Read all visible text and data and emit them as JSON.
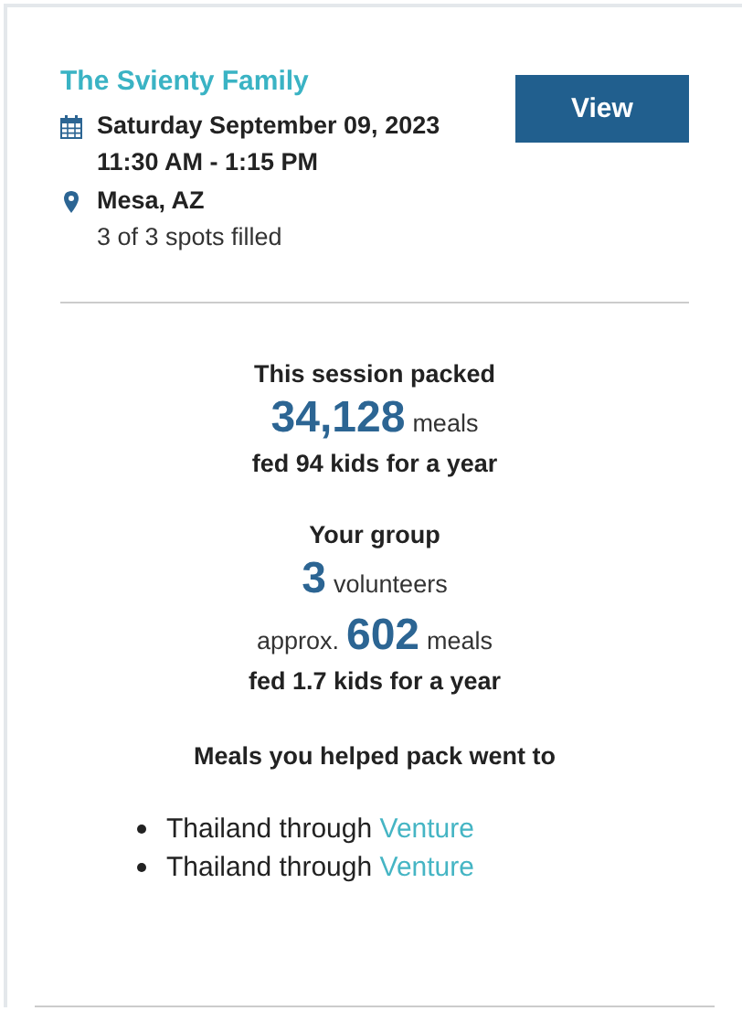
{
  "event": {
    "title": "The Svienty Family",
    "date": "Saturday September 09, 2023",
    "time": "11:30 AM - 1:15 PM",
    "location": "Mesa, AZ",
    "spots": "3 of 3 spots filled",
    "button": "View"
  },
  "session": {
    "heading": "This session packed",
    "count": "34,128",
    "unit": "meals",
    "impact": "fed 94 kids for a year"
  },
  "group": {
    "heading": "Your group",
    "volunteers": "3",
    "volunteers_unit": "volunteers",
    "approx": "approx.",
    "meals": "602",
    "meals_unit": "meals",
    "impact": "fed 1.7 kids for a year"
  },
  "destinations": {
    "heading": "Meals you helped pack went to",
    "items": [
      {
        "text": "Thailand through",
        "link": "Venture"
      },
      {
        "text": "Thailand through",
        "link": "Venture"
      }
    ]
  }
}
